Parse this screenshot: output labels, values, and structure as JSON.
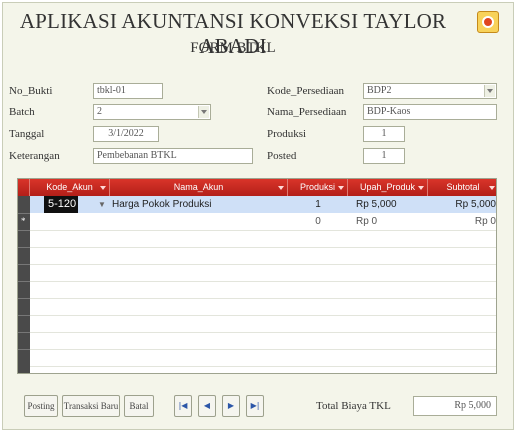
{
  "header": {
    "title": "APLIKASI AKUNTANSI KONVEKSI TAYLOR ABADI",
    "subtitle": "FORM BTKL"
  },
  "form": {
    "no_bukti": {
      "label": "No_Bukti",
      "value": "tbkl-01"
    },
    "batch": {
      "label": "Batch",
      "value": "2"
    },
    "tanggal": {
      "label": "Tanggal",
      "value": "3/1/2022"
    },
    "keterangan": {
      "label": "Keterangan",
      "value": "Pembebanan BTKL"
    },
    "kode_persediaan": {
      "label": "Kode_Persediaan",
      "value": "BDP2"
    },
    "nama_persediaan": {
      "label": "Nama_Persediaan",
      "value": "BDP-Kaos"
    },
    "produksi": {
      "label": "Produksi",
      "value": "1"
    },
    "posted": {
      "label": "Posted",
      "value": "1"
    }
  },
  "table": {
    "columns": [
      "Kode_Akun",
      "Nama_Akun",
      "Produksi",
      "Upah_Produk",
      "Subtotal"
    ],
    "rows": [
      {
        "kode_akun": "5-120",
        "nama_akun": "Harga Pokok Produksi",
        "produksi": "1",
        "upah_produk": "Rp 5,000",
        "subtotal": "Rp 5,000"
      },
      {
        "kode_akun": "",
        "nama_akun": "",
        "produksi": "0",
        "upah_produk": "Rp 0",
        "subtotal": "Rp 0"
      }
    ]
  },
  "footer": {
    "posting_label": "Posting",
    "new_label": "Transaksi Baru",
    "cancel_label": "Batal",
    "nav_first": "|◀",
    "nav_prev": "◀",
    "nav_next": "▶",
    "nav_last": "▶|",
    "total_label": "Total Biaya TKL",
    "total_value": "Rp 5,000"
  },
  "colors": {
    "header_bar": "#c62a22",
    "selected_row": "#cfe0f7",
    "background": "#f4f5ea"
  },
  "icons": {
    "close": "close-icon"
  }
}
